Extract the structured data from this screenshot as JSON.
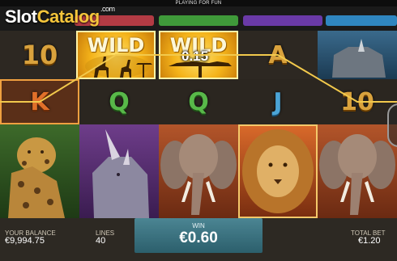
{
  "header": {
    "mode_text": "PLAYING FOR FUN"
  },
  "watermark": {
    "brand_part1": "Slot",
    "brand_part2": "Catalog",
    "brand_suffix": ".com"
  },
  "reels": {
    "row0": [
      {
        "symbol": "10",
        "kind": "letter"
      },
      {
        "symbol": "WILD",
        "kind": "wild"
      },
      {
        "symbol": "WILD",
        "kind": "wild",
        "win_amount": "0.15"
      },
      {
        "symbol": "A",
        "kind": "letter"
      },
      {
        "symbol": "rhino-blue",
        "kind": "animal"
      }
    ],
    "row1": [
      {
        "symbol": "K",
        "kind": "letter"
      },
      {
        "symbol": "Q",
        "kind": "letter"
      },
      {
        "symbol": "Q",
        "kind": "letter"
      },
      {
        "symbol": "J",
        "kind": "letter"
      },
      {
        "symbol": "10",
        "kind": "letter"
      }
    ],
    "row2": [
      {
        "symbol": "leopard",
        "kind": "animal"
      },
      {
        "symbol": "rhino",
        "kind": "animal"
      },
      {
        "symbol": "elephant",
        "kind": "animal"
      },
      {
        "symbol": "lion",
        "kind": "animal"
      },
      {
        "symbol": "elephant",
        "kind": "animal"
      }
    ]
  },
  "footer": {
    "balance_label": "YOUR BALANCE",
    "balance_value": "€9,994.75",
    "lines_label": "LINES",
    "lines_value": "40",
    "win_label": "WIN",
    "win_value": "€0.60",
    "total_bet_label": "TOTAL BET",
    "total_bet_value": "€1.20"
  },
  "colors": {
    "win_panel": "#3f7a88",
    "wild_gold": "#f4b31a",
    "payline": "#f2c94c"
  }
}
